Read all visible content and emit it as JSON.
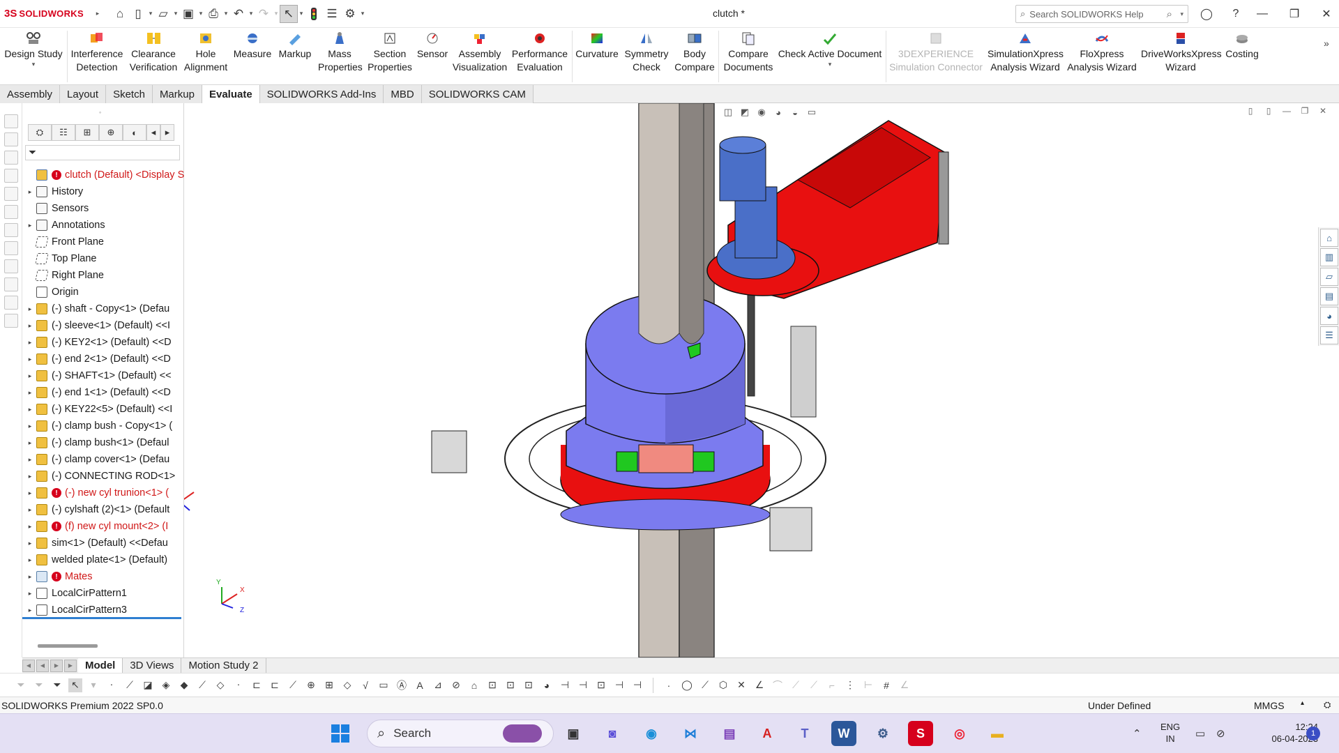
{
  "app": {
    "logo_ds": "3S",
    "logo_name": "SOLIDWORKS",
    "document_title": "clutch *",
    "search_placeholder": "Search SOLIDWORKS Help"
  },
  "ribbon": {
    "buttons": [
      {
        "label": "Design Study",
        "icon": "design-study-icon"
      },
      {
        "label": "Interference Detection",
        "icon": "interference-detection-icon"
      },
      {
        "label": "Clearance Verification",
        "icon": "clearance-verification-icon"
      },
      {
        "label": "Hole Alignment",
        "icon": "hole-alignment-icon"
      },
      {
        "label": "Measure",
        "icon": "measure-icon"
      },
      {
        "label": "Markup",
        "icon": "markup-icon"
      },
      {
        "label": "Mass Properties",
        "icon": "mass-properties-icon"
      },
      {
        "label": "Section Properties",
        "icon": "section-properties-icon"
      },
      {
        "label": "Sensor",
        "icon": "sensor-icon"
      },
      {
        "label": "Assembly Visualization",
        "icon": "assembly-visualization-icon"
      },
      {
        "label": "Performance Evaluation",
        "icon": "performance-evaluation-icon"
      },
      {
        "label": "Curvature",
        "icon": "curvature-icon"
      },
      {
        "label": "Symmetry Check",
        "icon": "symmetry-check-icon"
      },
      {
        "label": "Body Compare",
        "icon": "body-compare-icon"
      },
      {
        "label": "Compare Documents",
        "icon": "compare-documents-icon"
      },
      {
        "label": "Check Active Document",
        "icon": "check-active-document-icon"
      },
      {
        "label": "3DEXPERIENCE Simulation Connector",
        "icon": "3dexperience-icon",
        "disabled": true
      },
      {
        "label": "SimulationXpress Analysis Wizard",
        "icon": "simulationxpress-icon"
      },
      {
        "label": "FloXpress Analysis Wizard",
        "icon": "floxpress-icon"
      },
      {
        "label": "DriveWorksXpress Wizard",
        "icon": "driveworksxpress-icon"
      },
      {
        "label": "Costing",
        "icon": "costing-icon"
      }
    ],
    "dropdown_caret": "▾"
  },
  "tabs": [
    "Assembly",
    "Layout",
    "Sketch",
    "Markup",
    "Evaluate",
    "SOLIDWORKS Add-Ins",
    "MBD",
    "SOLIDWORKS CAM"
  ],
  "active_tab": "Evaluate",
  "feature_tree": [
    {
      "label": "clutch (Default) <Display S",
      "icon": "assembly-icon",
      "warn": true,
      "red": true,
      "expand": false
    },
    {
      "label": "History",
      "icon": "folder-icon",
      "expand": true
    },
    {
      "label": "Sensors",
      "icon": "folder-icon",
      "expand": false
    },
    {
      "label": "Annotations",
      "icon": "folder-icon",
      "expand": true
    },
    {
      "label": "Front Plane",
      "icon": "plane-icon",
      "expand": false
    },
    {
      "label": "Top Plane",
      "icon": "plane-icon",
      "expand": false
    },
    {
      "label": "Right Plane",
      "icon": "plane-icon",
      "expand": false
    },
    {
      "label": "Origin",
      "icon": "origin-icon",
      "expand": false
    },
    {
      "label": "(-) shaft - Copy<1> (Defau",
      "icon": "part-icon",
      "expand": true
    },
    {
      "label": "(-) sleeve<1> (Default) <<I",
      "icon": "part-icon",
      "expand": true
    },
    {
      "label": "(-) KEY2<1> (Default) <<D",
      "icon": "part-icon",
      "expand": true
    },
    {
      "label": "(-) end 2<1> (Default) <<D",
      "icon": "part-icon",
      "expand": true
    },
    {
      "label": "(-) SHAFT<1> (Default) <<",
      "icon": "part-icon",
      "expand": true
    },
    {
      "label": "(-) end 1<1> (Default) <<D",
      "icon": "part-icon",
      "expand": true
    },
    {
      "label": "(-) KEY22<5> (Default) <<I",
      "icon": "part-icon",
      "expand": true
    },
    {
      "label": "(-) clamp bush - Copy<1> (",
      "icon": "part-icon",
      "expand": true
    },
    {
      "label": "(-) clamp bush<1> (Defaul",
      "icon": "part-icon",
      "expand": true
    },
    {
      "label": "(-) clamp cover<1> (Defau",
      "icon": "part-icon",
      "expand": true
    },
    {
      "label": "(-) CONNECTING ROD<1>",
      "icon": "part-icon",
      "expand": true
    },
    {
      "label": "(-) new cyl trunion<1> (",
      "icon": "part-icon",
      "warn": true,
      "red": true,
      "expand": true
    },
    {
      "label": "(-) cylshaft (2)<1> (Default",
      "icon": "part-icon",
      "expand": true
    },
    {
      "label": "(f) new cyl mount<2> (I",
      "icon": "part-icon",
      "warn": true,
      "red": true,
      "expand": true
    },
    {
      "label": "sim<1> (Default) <<Defau",
      "icon": "part-icon",
      "expand": true
    },
    {
      "label": "welded plate<1> (Default)",
      "icon": "part-icon",
      "expand": true
    },
    {
      "label": "Mates",
      "icon": "mates-icon",
      "warn": true,
      "red": true,
      "expand": true
    },
    {
      "label": "LocalCirPattern1",
      "icon": "pattern-icon",
      "expand": true
    },
    {
      "label": "LocalCirPattern3",
      "icon": "pattern-icon",
      "expand": true
    }
  ],
  "triad": {
    "x": "X",
    "y": "Y",
    "z": "Z"
  },
  "model_tabs": [
    "Model",
    "3D Views",
    "Motion Study 2"
  ],
  "active_model_tab": "Model",
  "status": {
    "app_version": "SOLIDWORKS Premium 2022 SP0.0",
    "definition": "Under Defined",
    "units": "MMGS",
    "units_caret": "▴"
  },
  "taskbar": {
    "search_label": "Search",
    "lang_line1": "ENG",
    "lang_line2": "IN",
    "time": "12:24",
    "date": "06-04-2023",
    "notifications": "1"
  },
  "colors": {
    "brand_red": "#d6001c",
    "part_blue": "#7b7bef",
    "part_red": "#e81010",
    "shaft_gray": "#c4bcb4"
  }
}
